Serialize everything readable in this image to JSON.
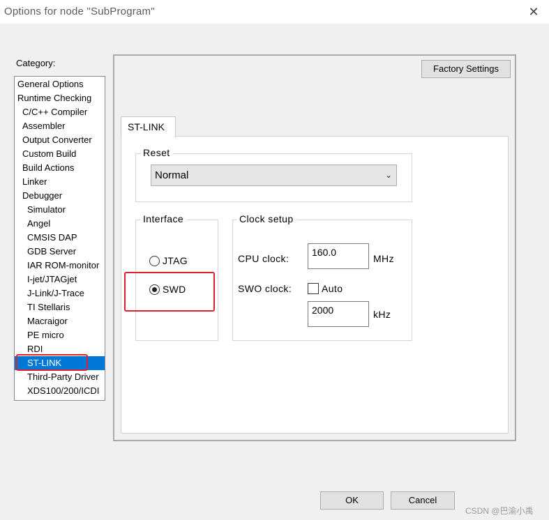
{
  "window": {
    "title": "Options for node \"SubProgram\"",
    "close_glyph": "✕"
  },
  "category": {
    "label": "Category:",
    "selected": "ST-LINK",
    "items": [
      {
        "label": "General Options",
        "level": 0
      },
      {
        "label": "Runtime Checking",
        "level": 0
      },
      {
        "label": "C/C++ Compiler",
        "level": 1
      },
      {
        "label": "Assembler",
        "level": 1
      },
      {
        "label": "Output Converter",
        "level": 1
      },
      {
        "label": "Custom Build",
        "level": 1
      },
      {
        "label": "Build Actions",
        "level": 1
      },
      {
        "label": "Linker",
        "level": 1
      },
      {
        "label": "Debugger",
        "level": 1
      },
      {
        "label": "Simulator",
        "level": 2
      },
      {
        "label": "Angel",
        "level": 2
      },
      {
        "label": "CMSIS DAP",
        "level": 2
      },
      {
        "label": "GDB Server",
        "level": 2
      },
      {
        "label": "IAR ROM-monitor",
        "level": 2
      },
      {
        "label": "I-jet/JTAGjet",
        "level": 2
      },
      {
        "label": "J-Link/J-Trace",
        "level": 2
      },
      {
        "label": "TI Stellaris",
        "level": 2
      },
      {
        "label": "Macraigor",
        "level": 2
      },
      {
        "label": "PE micro",
        "level": 2
      },
      {
        "label": "RDI",
        "level": 2
      },
      {
        "label": "ST-LINK",
        "level": 2
      },
      {
        "label": "Third-Party Driver",
        "level": 2
      },
      {
        "label": "XDS100/200/ICDI",
        "level": 2
      }
    ]
  },
  "panel": {
    "factory_settings_label": "Factory Settings",
    "tab_label": "ST-LINK",
    "reset": {
      "group_title": "Reset",
      "selected_value": "Normal",
      "chevron": "⌄"
    },
    "interface": {
      "group_title": "Interface",
      "options": [
        "JTAG",
        "SWD"
      ],
      "selected": "SWD"
    },
    "clock": {
      "group_title": "Clock setup",
      "cpu_label": "CPU clock:",
      "cpu_value": "160.0",
      "cpu_unit": "MHz",
      "swo_label": "SWO clock:",
      "auto_label": "Auto",
      "auto_checked": false,
      "swo_value": "2000",
      "swo_unit": "kHz"
    }
  },
  "footer": {
    "ok_label": "OK",
    "cancel_label": "Cancel",
    "watermark": "CSDN @巴渝小禹"
  },
  "colors": {
    "selection": "#0078d7",
    "highlight_box": "#e0202b"
  }
}
